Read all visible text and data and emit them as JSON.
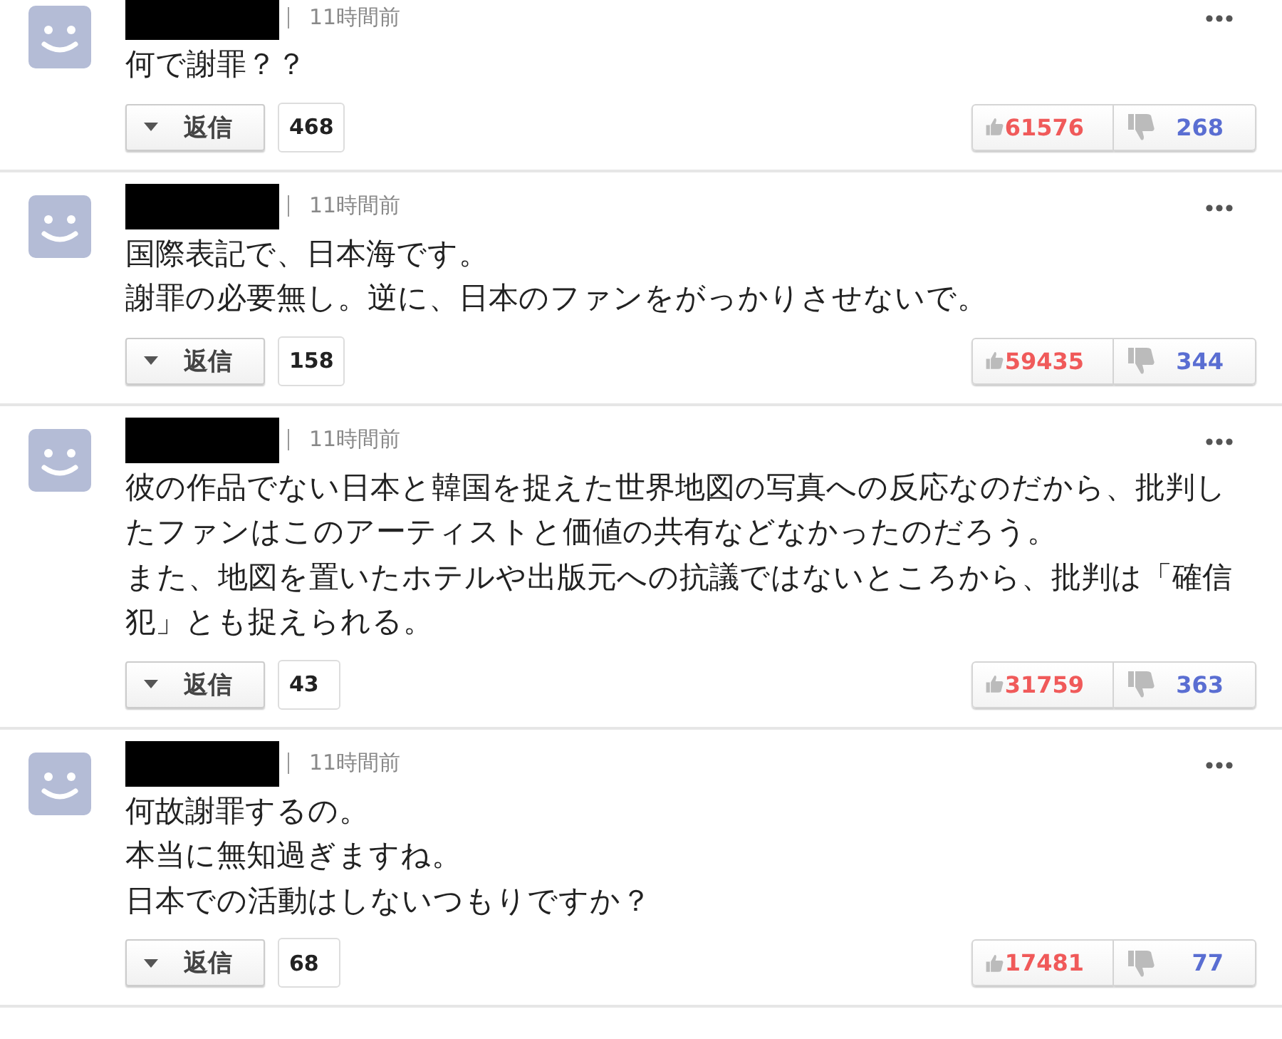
{
  "comments": [
    {
      "time": "11時間前",
      "paragraphs": [
        "何で謝罪？？"
      ],
      "reply_label": "返信",
      "reply_count": "468",
      "likes": "61576",
      "dislikes": "268"
    },
    {
      "time": "11時間前",
      "paragraphs": [
        "国際表記で、日本海です。",
        "謝罪の必要無し。逆に、日本のファンをがっかりさせないで。"
      ],
      "reply_label": "返信",
      "reply_count": "158",
      "likes": "59435",
      "dislikes": "344"
    },
    {
      "time": "11時間前",
      "paragraphs": [
        "彼の作品でない日本と韓国を捉えた世界地図の写真への反応なのだから、批判したファンはこのアーティストと価値の共有などなかったのだろう。",
        "また、地図を置いたホテルや出版元への抗議ではないところから、批判は「確信犯」とも捉えられる。"
      ],
      "reply_label": "返信",
      "reply_count": "43",
      "likes": "31759",
      "dislikes": "363"
    },
    {
      "time": "11時間前",
      "paragraphs": [
        "何故謝罪するの。",
        "本当に無知過ぎますね。",
        "日本での活動はしないつもりですか？"
      ],
      "reply_label": "返信",
      "reply_count": "68",
      "likes": "17481",
      "dislikes": "77"
    }
  ]
}
